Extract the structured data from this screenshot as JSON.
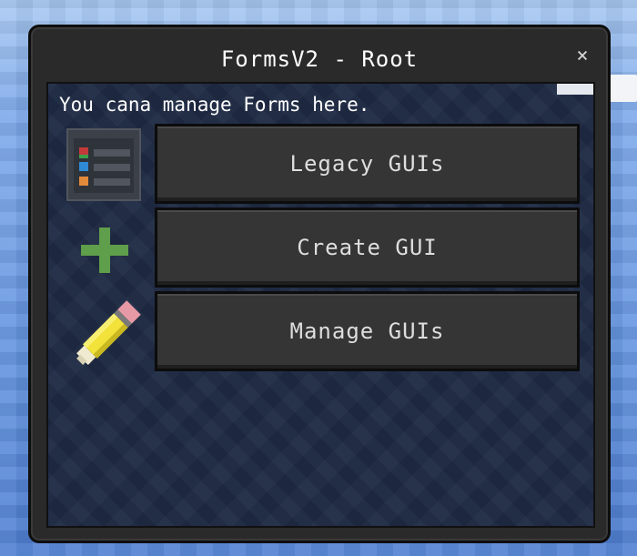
{
  "dialog": {
    "title": "FormsV2 - Root",
    "close_label": "×",
    "description": "You cana manage Forms here."
  },
  "buttons": [
    {
      "label": "Legacy GUIs",
      "icon": "list-icon"
    },
    {
      "label": "Create GUI",
      "icon": "plus-icon"
    },
    {
      "label": "Manage GUIs",
      "icon": "pencil-icon"
    }
  ],
  "colors": {
    "dialog_bg": "#2a2a2a",
    "button_bg": "#353535",
    "panel_bg": "#1f2b44",
    "plus_green": "#5f9e4a",
    "pencil_yellow": "#f2e23a"
  }
}
